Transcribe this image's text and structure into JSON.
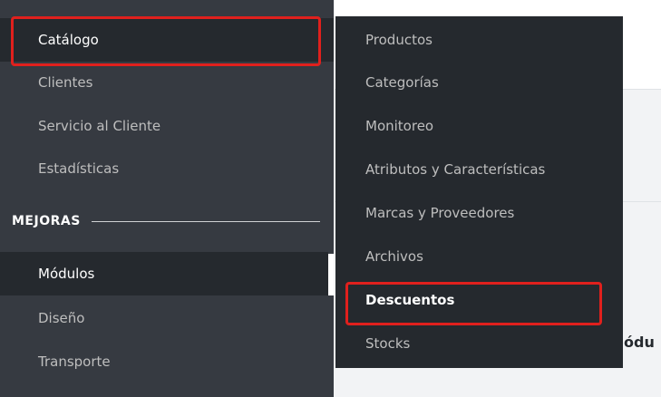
{
  "sidebar": {
    "items": [
      {
        "label": "Catálogo"
      },
      {
        "label": "Clientes"
      },
      {
        "label": "Servicio al Cliente"
      },
      {
        "label": "Estadísticas"
      }
    ],
    "section_header": "MEJORAS",
    "section_items": [
      {
        "label": "Módulos"
      },
      {
        "label": "Diseño"
      },
      {
        "label": "Transporte"
      }
    ]
  },
  "submenu": {
    "items": [
      {
        "label": "Productos"
      },
      {
        "label": "Categorías"
      },
      {
        "label": "Monitoreo"
      },
      {
        "label": "Atributos y Características"
      },
      {
        "label": "Marcas y Proveedores"
      },
      {
        "label": "Archivos"
      },
      {
        "label": "Descuentos"
      },
      {
        "label": "Stocks"
      }
    ]
  },
  "page": {
    "heading_fragment": "ódu"
  },
  "colors": {
    "sidebar_bg": "#363a41",
    "active_bg": "#25292e",
    "highlight": "#e0201d"
  }
}
